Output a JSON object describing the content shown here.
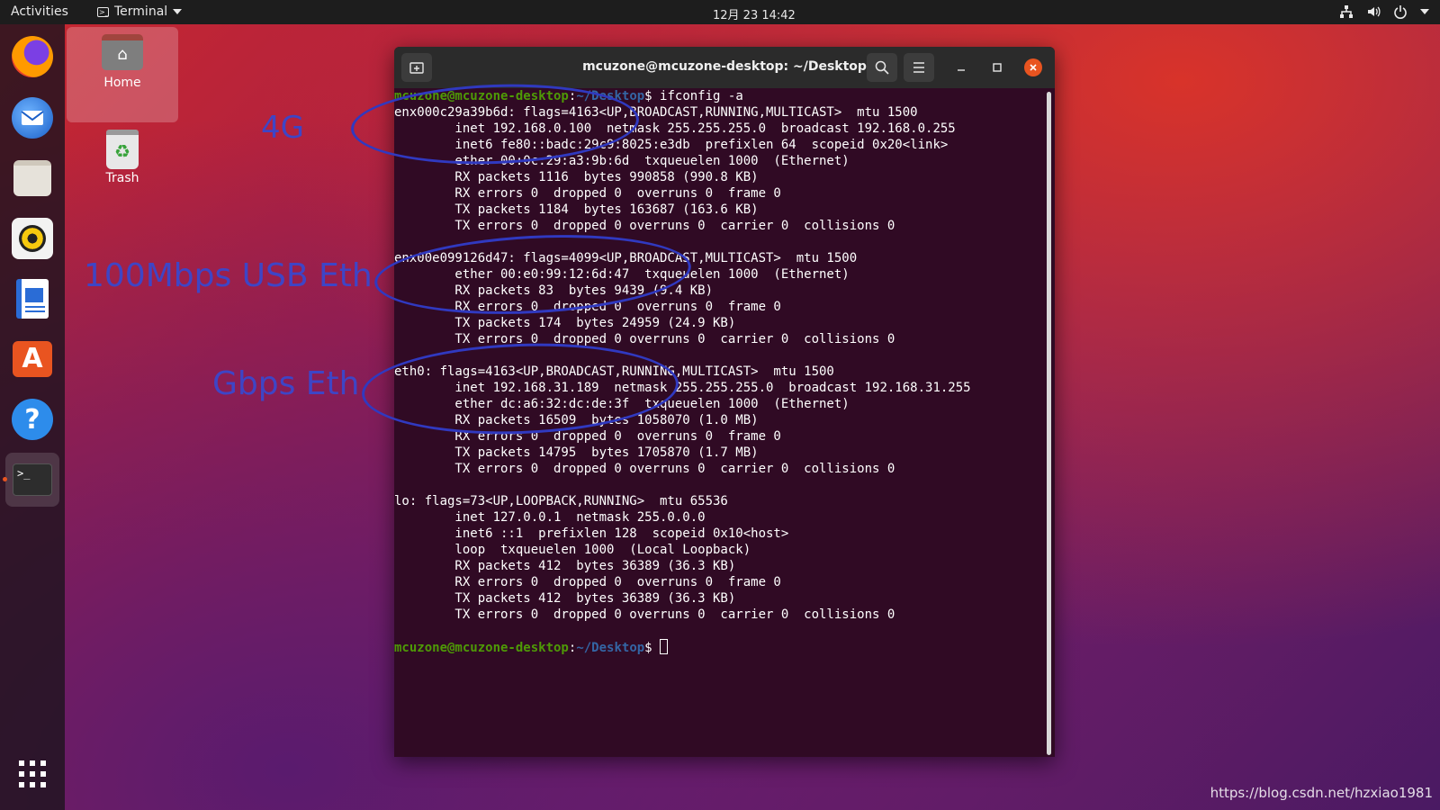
{
  "topbar": {
    "activities": "Activities",
    "app_name": "Terminal",
    "clock": "12月 23  14:42",
    "network_icon": "network-icon",
    "volume_icon": "volume-icon",
    "power_icon": "power-icon"
  },
  "dock": {
    "apps": [
      {
        "name": "firefox-icon"
      },
      {
        "name": "thunderbird-icon"
      },
      {
        "name": "files-icon"
      },
      {
        "name": "rhythmbox-icon"
      },
      {
        "name": "libreoffice-writer-icon"
      },
      {
        "name": "software-center-icon"
      },
      {
        "name": "help-icon"
      },
      {
        "name": "terminal-icon"
      }
    ],
    "show_apps_icon": "grid-icon"
  },
  "desktop": {
    "home_label": "Home",
    "trash_label": "Trash"
  },
  "annotations": {
    "a4g": "4G",
    "usb": "100Mbps USB Eth",
    "gbps": "Gbps Eth"
  },
  "terminal": {
    "title": "mcuzone@mcuzone-desktop: ~/Desktop",
    "prompt_user": "mcuzone@mcuzone-desktop",
    "prompt_colon": ":",
    "prompt_path": "~/Desktop",
    "prompt_dollar": "$ ",
    "command": "ifconfig -a",
    "lines": [
      "enx000c29a39b6d: flags=4163<UP,BROADCAST,RUNNING,MULTICAST>  mtu 1500",
      "        inet 192.168.0.100  netmask 255.255.255.0  broadcast 192.168.0.255",
      "        inet6 fe80::badc:29c9:8025:e3db  prefixlen 64  scopeid 0x20<link>",
      "        ether 00:0c:29:a3:9b:6d  txqueuelen 1000  (Ethernet)",
      "        RX packets 1116  bytes 990858 (990.8 KB)",
      "        RX errors 0  dropped 0  overruns 0  frame 0",
      "        TX packets 1184  bytes 163687 (163.6 KB)",
      "        TX errors 0  dropped 0 overruns 0  carrier 0  collisions 0",
      "",
      "enx00e099126d47: flags=4099<UP,BROADCAST,MULTICAST>  mtu 1500",
      "        ether 00:e0:99:12:6d:47  txqueuelen 1000  (Ethernet)",
      "        RX packets 83  bytes 9439 (9.4 KB)",
      "        RX errors 0  dropped 0  overruns 0  frame 0",
      "        TX packets 174  bytes 24959 (24.9 KB)",
      "        TX errors 0  dropped 0 overruns 0  carrier 0  collisions 0",
      "",
      "eth0: flags=4163<UP,BROADCAST,RUNNING,MULTICAST>  mtu 1500",
      "        inet 192.168.31.189  netmask 255.255.255.0  broadcast 192.168.31.255",
      "        ether dc:a6:32:dc:de:3f  txqueuelen 1000  (Ethernet)",
      "        RX packets 16509  bytes 1058070 (1.0 MB)",
      "        RX errors 0  dropped 0  overruns 0  frame 0",
      "        TX packets 14795  bytes 1705870 (1.7 MB)",
      "        TX errors 0  dropped 0 overruns 0  carrier 0  collisions 0",
      "",
      "lo: flags=73<UP,LOOPBACK,RUNNING>  mtu 65536",
      "        inet 127.0.0.1  netmask 255.0.0.0",
      "        inet6 ::1  prefixlen 128  scopeid 0x10<host>",
      "        loop  txqueuelen 1000  (Local Loopback)",
      "        RX packets 412  bytes 36389 (36.3 KB)",
      "        RX errors 0  dropped 0  overruns 0  frame 0",
      "        TX packets 412  bytes 36389 (36.3 KB)",
      "        TX errors 0  dropped 0 overruns 0  carrier 0  collisions 0",
      ""
    ]
  },
  "watermark": "https://blog.csdn.net/hzxiao1981",
  "colors": {
    "terminal_bg": "#300a24",
    "prompt_user": "#4e9a06",
    "prompt_path": "#3465a4",
    "annotation": "#3039c0",
    "close_button": "#e95420"
  }
}
